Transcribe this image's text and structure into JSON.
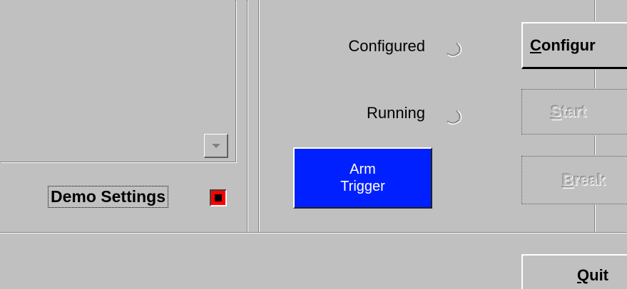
{
  "left": {
    "demo_settings_label": "Demo Settings",
    "demo_led_color": "#ff0000"
  },
  "status": {
    "configured_label": "Configured",
    "running_label": "Running"
  },
  "buttons": {
    "configure_label_accel": "C",
    "configure_label_rest": "onfigur",
    "start_label_accel": "S",
    "start_label_rest": "tart",
    "break_label_accel": "B",
    "break_label_rest": "reak",
    "quit_label_accel": "Q",
    "quit_label_rest": "uit",
    "arm_trigger_line1": "Arm",
    "arm_trigger_line2": "Trigger",
    "arm_trigger_color": "#0020ff"
  }
}
